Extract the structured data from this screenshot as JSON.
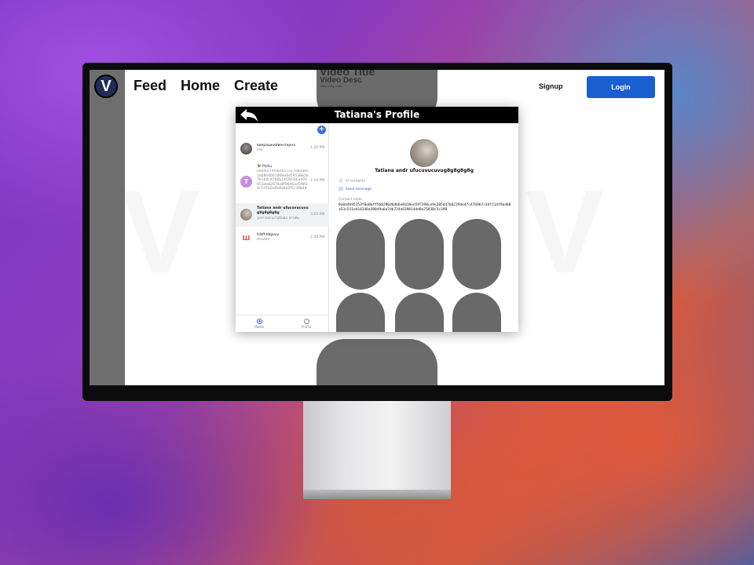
{
  "site": {
    "nav": [
      "Feed",
      "Home",
      "Create"
    ],
    "logo_letter": "V",
    "video_title": "Video Title",
    "video_desc": "Video Desc",
    "video_sub": "video long name",
    "signup_label": "Signup",
    "login_label": "Login"
  },
  "modal": {
    "title": "Tatiana's Profile",
    "add_label": "+"
  },
  "chats": [
    {
      "name": "виерашкийвентерна",
      "sub": "Hhr",
      "time": "1:20 PM",
      "avatar_color": "#5a524c",
      "avatar_letter": "",
      "active": false
    },
    {
      "name": "🐓 Pichu",
      "sub": "0x04f274f9b0657317e83d853a68e4661468d4d59138b2b7b1b0cd7b6b14f2b5b6ad95653de82674e8f96d6ed5f8f24c1d7b5e6b8a8d2f5c39849",
      "time": "1:19 PM",
      "avatar_color": "#c98be0",
      "avatar_letter": "T",
      "active": false
    },
    {
      "name": "Tatiana andr ufucuvucuvu g8g8g8g8g",
      "sub": "для масштабова отабь",
      "time": "3:16 PM",
      "avatar_color": "#8a8079",
      "avatar_letter": "",
      "active": true
    },
    {
      "name": "tcbff hbgvvy",
      "sub": "Hrvdez",
      "time": "1:08 PM",
      "avatar_color": "#ffffff",
      "avatar_letter": "Ш",
      "active": false
    }
  ],
  "tabs": [
    {
      "label": "Home",
      "active": true
    },
    {
      "label": "Profile",
      "active": false
    }
  ],
  "profile": {
    "name": "Tatiana andr ufucuvucuvug8g8g8g8g",
    "in_contacts": "In contacts",
    "send_message": "Send message",
    "contact_code_label": "Contact code",
    "contact_code": "0x044b95153f0e0bff568286d6db6e8d18ee597398ce9e205d47b6239de47c4769b7c34f21df9a4b8a53c551ed18146a39049a6a7db724e639014dd8a7583Bc5c398"
  },
  "colors": {
    "login_button": "#1a5fcf",
    "accent": "#3d6be8",
    "placeholder_tile": "#696969",
    "sidebar": "#6e6e6e"
  }
}
